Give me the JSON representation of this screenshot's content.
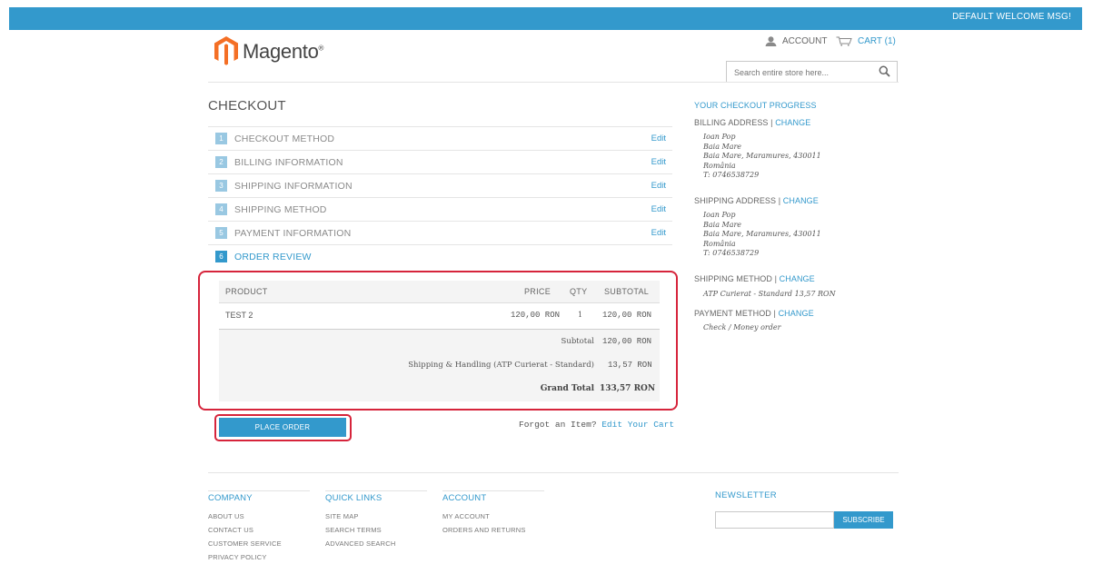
{
  "header": {
    "welcome": "DEFAULT WELCOME MSG!",
    "logo_text": "Magento",
    "logo_mark": "®",
    "account_label": "ACCOUNT",
    "cart_label": "CART (1)",
    "search_placeholder": "Search entire store here...",
    "brand_color": "#3399cc",
    "logo_color": "#f46f25"
  },
  "checkout": {
    "title": "CHECKOUT",
    "steps": [
      {
        "num": "1",
        "label": "CHECKOUT METHOD",
        "edit": "Edit"
      },
      {
        "num": "2",
        "label": "BILLING INFORMATION",
        "edit": "Edit"
      },
      {
        "num": "3",
        "label": "SHIPPING INFORMATION",
        "edit": "Edit"
      },
      {
        "num": "4",
        "label": "SHIPPING METHOD",
        "edit": "Edit"
      },
      {
        "num": "5",
        "label": "PAYMENT INFORMATION",
        "edit": "Edit"
      },
      {
        "num": "6",
        "label": "ORDER REVIEW"
      }
    ],
    "review": {
      "headers": {
        "product": "PRODUCT",
        "price": "PRICE",
        "qty": "QTY",
        "subtotal": "SUBTOTAL"
      },
      "item": {
        "name": "TEST 2",
        "price": "120,00 RON",
        "qty": "1",
        "subtotal": "120,00 RON"
      },
      "totals": [
        {
          "label": "Subtotal",
          "value": "120,00 RON"
        },
        {
          "label": "Shipping & Handling (ATP Curierat - Standard)",
          "value": "13,57 RON"
        }
      ],
      "grand_total": {
        "label": "Grand Total",
        "value": "133,57 RON"
      }
    },
    "place_order": "PLACE ORDER",
    "forgot_text": "Forgot an Item?",
    "edit_cart": "Edit Your Cart"
  },
  "progress": {
    "title": "YOUR CHECKOUT PROGRESS",
    "billing": {
      "heading": "BILLING ADDRESS |",
      "change": "CHANGE",
      "lines": [
        "Ioan Pop",
        "Baia Mare",
        "Baia Mare, Maramures, 430011",
        "România",
        "T: 0746538729"
      ]
    },
    "shipping": {
      "heading": "SHIPPING ADDRESS |",
      "change": "CHANGE",
      "lines": [
        "Ioan Pop",
        "Baia Mare",
        "Baia Mare, Maramures, 430011",
        "România",
        "T: 0746538729"
      ]
    },
    "shipping_method": {
      "heading": "SHIPPING METHOD |",
      "change": "CHANGE",
      "value": "ATP Curierat - Standard 13,57 RON"
    },
    "payment_method": {
      "heading": "PAYMENT METHOD |",
      "change": "CHANGE",
      "value": "Check / Money order"
    }
  },
  "footer": {
    "company": {
      "title": "COMPANY",
      "links": [
        "ABOUT US",
        "CONTACT US",
        "CUSTOMER SERVICE",
        "PRIVACY POLICY"
      ]
    },
    "quick_links": {
      "title": "QUICK LINKS",
      "links": [
        "SITE MAP",
        "SEARCH TERMS",
        "ADVANCED SEARCH"
      ]
    },
    "account": {
      "title": "ACCOUNT",
      "links": [
        "MY ACCOUNT",
        "ORDERS AND RETURNS"
      ]
    },
    "newsletter": {
      "title": "NEWSLETTER",
      "button": "SUBSCRIBE"
    }
  }
}
